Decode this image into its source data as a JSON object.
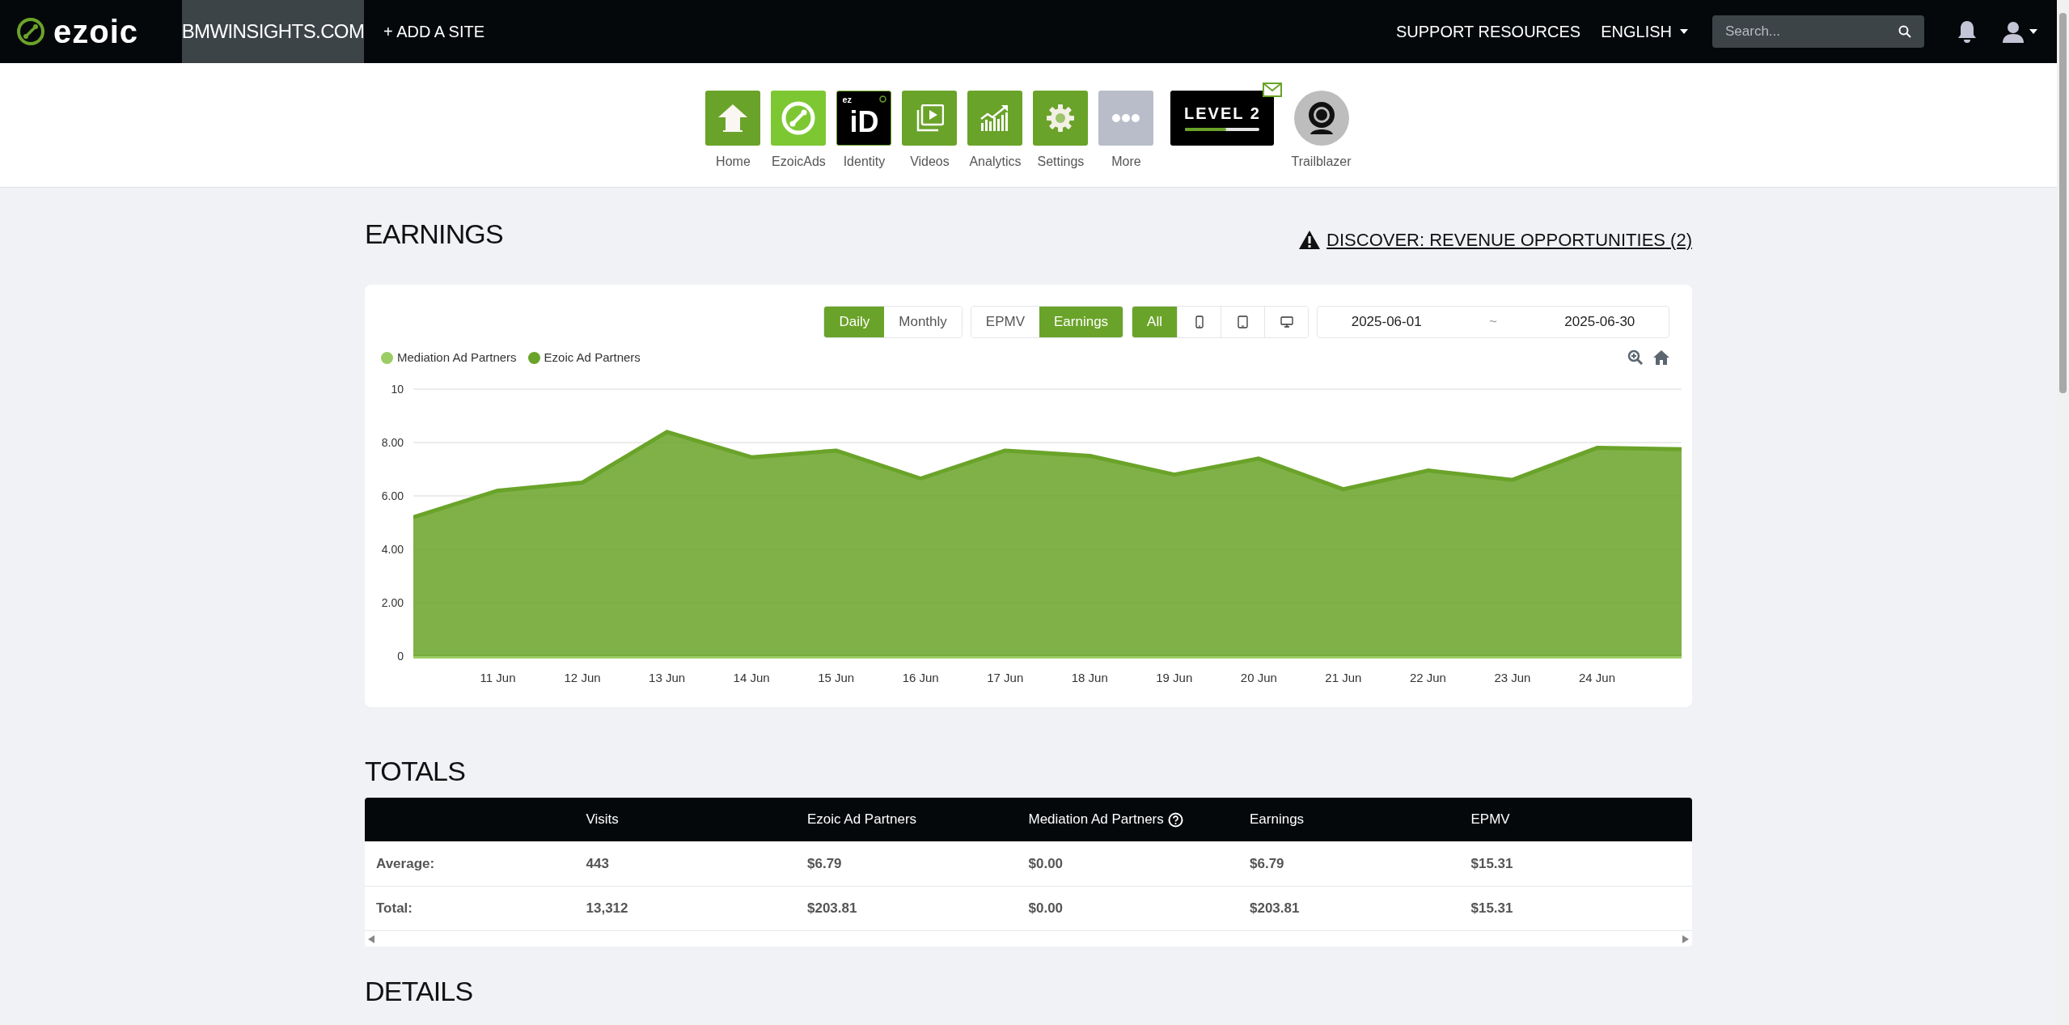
{
  "top_bar": {
    "logo": "ezoic",
    "site": "BMWINSIGHTS.COM",
    "add_site": "+ ADD A SITE",
    "support": "SUPPORT RESOURCES",
    "language": "ENGLISH",
    "search": {
      "placeholder": "Search..."
    }
  },
  "app_nav": [
    {
      "kind": "home",
      "label": "Home"
    },
    {
      "kind": "ads",
      "label": "EzoicAds"
    },
    {
      "kind": "identity",
      "label": "Identity",
      "icon_text": "iD",
      "icon_badge": "ez"
    },
    {
      "kind": "videos",
      "label": "Videos"
    },
    {
      "kind": "analytics",
      "label": "Analytics"
    },
    {
      "kind": "settings",
      "label": "Settings"
    },
    {
      "kind": "more",
      "label": "More"
    },
    {
      "kind": "level",
      "badge": "LEVEL 2",
      "level": 0.55
    },
    {
      "kind": "avatar",
      "label": "Trailblazer"
    }
  ],
  "earnings": {
    "title": "EARNINGS",
    "discover_link": "DISCOVER: REVENUE OPPORTUNITIES (2)",
    "controls": [
      [
        {
          "kind": "text",
          "label": "Daily",
          "selected": true
        },
        {
          "kind": "text",
          "label": "Monthly",
          "selected": false
        }
      ],
      [
        {
          "kind": "text",
          "label": "EPMV",
          "selected": false
        },
        {
          "kind": "text",
          "label": "Earnings",
          "selected": true
        }
      ],
      [
        {
          "kind": "text",
          "label": "All",
          "selected": true
        },
        {
          "kind": "phone",
          "selected": false
        },
        {
          "kind": "tablet",
          "selected": false
        },
        {
          "kind": "desktop",
          "selected": false
        }
      ]
    ],
    "date_range": {
      "start": "2025-06-01",
      "separator": "~",
      "end": "2025-06-30"
    },
    "chart_data": {
      "type": "area",
      "categories": [
        null,
        "11 Jun",
        "12 Jun",
        "13 Jun",
        "14 Jun",
        "15 Jun",
        "16 Jun",
        "17 Jun",
        "18 Jun",
        "19 Jun",
        "20 Jun",
        "21 Jun",
        "22 Jun",
        "23 Jun",
        "24 Jun",
        null
      ],
      "ylim": [
        0,
        10
      ],
      "yticks": [
        0,
        {
          "value": 2,
          "label": "2.00"
        },
        {
          "value": 4,
          "label": "4.00"
        },
        {
          "value": 6,
          "label": "6.00"
        },
        {
          "value": 8,
          "label": "8.00"
        },
        10
      ],
      "series": [
        {
          "name": "Mediation Ad Partners",
          "color": "#9ccc65",
          "values": [
            0,
            0,
            0,
            0,
            0,
            0,
            0,
            0,
            0,
            0,
            0,
            0,
            0,
            0,
            0,
            0
          ]
        },
        {
          "name": "Ezoic Ad Partners",
          "color": "#6aa329",
          "values": [
            5.2,
            6.2,
            6.5,
            8.4,
            7.45,
            7.7,
            6.65,
            7.7,
            7.5,
            6.8,
            7.4,
            6.25,
            6.95,
            6.6,
            7.8,
            7.75
          ]
        }
      ]
    }
  },
  "totals": {
    "title": "TOTALS",
    "columns": [
      {
        "label": "Visits",
        "help": false
      },
      {
        "label": "Ezoic Ad Partners",
        "help": false
      },
      {
        "label": "Mediation Ad Partners",
        "help": true
      },
      {
        "label": "Earnings",
        "help": false
      },
      {
        "label": "EPMV",
        "help": false
      }
    ],
    "rows": [
      {
        "label": "Average:",
        "cells": [
          "443",
          "$6.79",
          "$0.00",
          "$6.79",
          "$15.31"
        ]
      },
      {
        "label": "Total:",
        "cells": [
          "13,312",
          "$203.81",
          "$0.00",
          "$203.81",
          "$15.31"
        ]
      }
    ]
  },
  "details": {
    "title": "DETAILS"
  }
}
